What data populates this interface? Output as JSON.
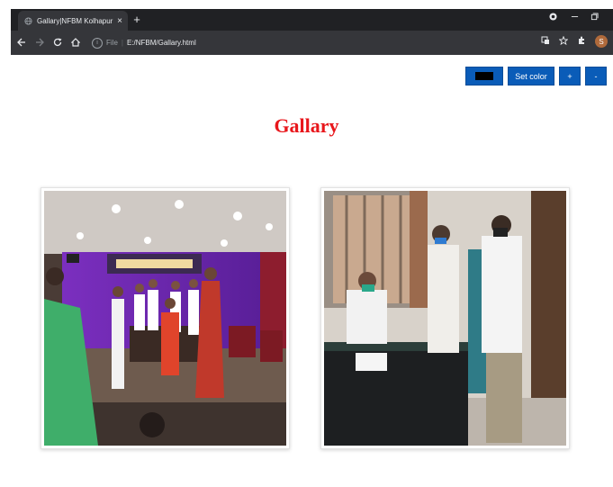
{
  "browser": {
    "tab_title": "Gallary|NFBM Kolhapur",
    "tab_close": "×",
    "new_tab": "+",
    "address_label": "File",
    "url": "E:/NFBM/Gallary.html",
    "profile_initial": "S"
  },
  "controls": {
    "set_color_label": "Set color",
    "increase_label": "+",
    "decrease_label": "-",
    "selected_color": "#000000"
  },
  "page": {
    "heading": "Gallary",
    "heading_color": "#e8161b"
  },
  "photos": [
    {
      "subject": "award ceremony on stage"
    },
    {
      "subject": "officials at an office desk"
    }
  ]
}
